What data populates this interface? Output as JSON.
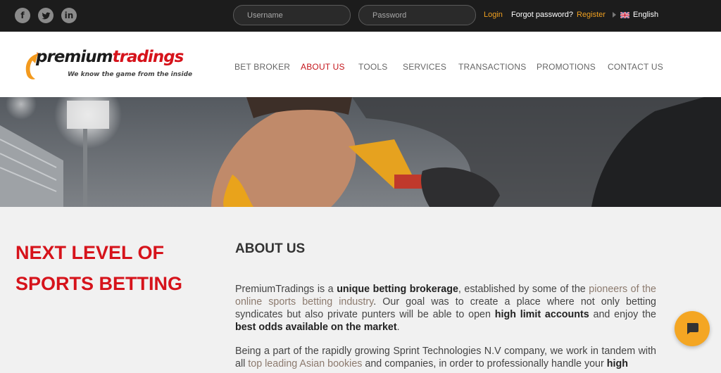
{
  "topbar": {
    "social": [
      "facebook-icon",
      "twitter-icon",
      "linkedin-icon"
    ],
    "social_glyphs": {
      "facebook": "f",
      "linkedin": "in"
    },
    "username_placeholder": "Username",
    "password_placeholder": "Password",
    "login": "Login",
    "forgot": "Forgot password?",
    "register": "Register",
    "language": "English"
  },
  "logo": {
    "main_dark": "premium",
    "main_accent": "tradings",
    "tagline": "We know the game from the inside"
  },
  "nav": {
    "items": [
      "BET BROKER",
      "ABOUT US",
      "TOOLS",
      "SERVICES",
      "TRANSACTIONS",
      "PROMOTIONS",
      "CONTACT US"
    ],
    "active": "ABOUT US"
  },
  "content": {
    "headline": "NEXT LEVEL OF SPORTS BETTING",
    "section_title": "ABOUT US",
    "para1": {
      "t1": "PremiumTradings is a ",
      "b1": "unique betting brokerage",
      "t2": ", established by some of the ",
      "h1": "pioneers of the online sports betting industry",
      "t3": ". Our goal was to create a place where not only betting syndicates but also private punters will be able to open ",
      "b2": "high limit accounts",
      "t4": " and enjoy the ",
      "b3": "best odds available on the market",
      "t5": "."
    },
    "para2": {
      "t1": "Being a part of the rapidly growing Sprint Technologies N.V company, we work in tandem with all ",
      "h1": "top leading Asian bookies",
      "t2": " and companies, in order to professionally handle your ",
      "b1": "high"
    }
  },
  "colors": {
    "accent_red": "#d6131b",
    "nav_active": "#c4161c",
    "link_orange": "#f0a020",
    "chat_button": "#f4a623",
    "topbar_bg": "#1c1c1c"
  },
  "chat": {
    "icon": "chat-bubble-icon"
  }
}
